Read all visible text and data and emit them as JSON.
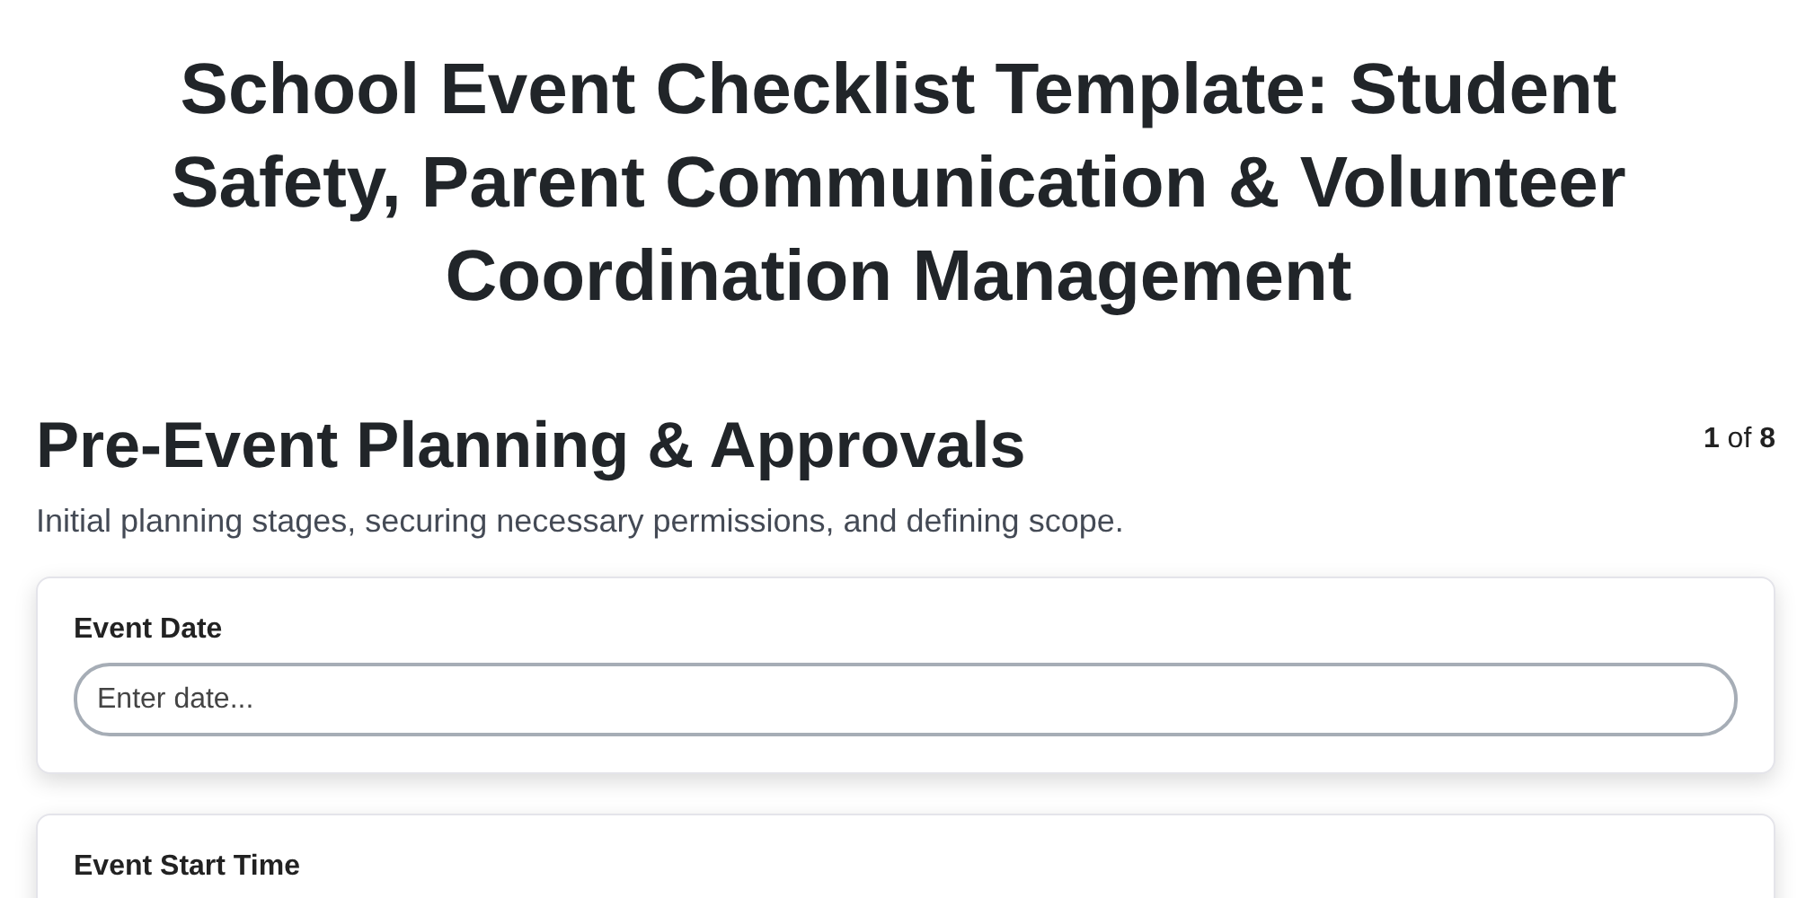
{
  "title": "School Event Checklist Template: Student Safety, Parent Communication & Volunteer Coordination Management",
  "section": {
    "heading": "Pre-Event Planning & Approvals",
    "counter": "**1** of **8**",
    "description": "Initial planning stages, securing necessary permissions, and defining scope."
  },
  "fields": [
    {
      "label": "Event Date",
      "placeholder": "Enter date..."
    },
    {
      "label": "Event Start Time"
    }
  ]
}
